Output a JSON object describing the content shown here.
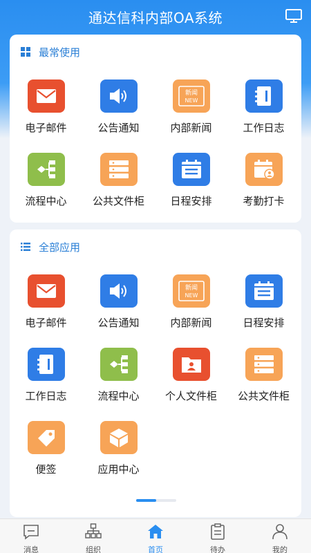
{
  "header": {
    "title": "通达信科内部OA系统",
    "right_icon": "monitor-icon"
  },
  "frequent": {
    "title": "最常使用",
    "icon": "grid-icon",
    "apps": [
      {
        "label": "电子邮件",
        "icon": "mail-icon",
        "color": "#e8502f"
      },
      {
        "label": "公告通知",
        "icon": "speaker-icon",
        "color": "#2f7de6"
      },
      {
        "label": "内部新闻",
        "icon": "news-icon",
        "color": "#f7a457"
      },
      {
        "label": "工作日志",
        "icon": "notebook-icon",
        "color": "#2f7de6"
      },
      {
        "label": "流程中心",
        "icon": "flow-icon",
        "color": "#8fbe4b"
      },
      {
        "label": "公共文件柜",
        "icon": "cabinet-icon",
        "color": "#f7a457"
      },
      {
        "label": "日程安排",
        "icon": "calendar-icon",
        "color": "#2f7de6"
      },
      {
        "label": "考勤打卡",
        "icon": "attendance-icon",
        "color": "#f7a457"
      }
    ]
  },
  "all": {
    "title": "全部应用",
    "icon": "list-icon",
    "apps": [
      {
        "label": "电子邮件",
        "icon": "mail-icon",
        "color": "#e8502f"
      },
      {
        "label": "公告通知",
        "icon": "speaker-icon",
        "color": "#2f7de6"
      },
      {
        "label": "内部新闻",
        "icon": "news-icon",
        "color": "#f7a457"
      },
      {
        "label": "日程安排",
        "icon": "calendar-icon",
        "color": "#2f7de6"
      },
      {
        "label": "工作日志",
        "icon": "notebook-icon",
        "color": "#2f7de6"
      },
      {
        "label": "流程中心",
        "icon": "flow-icon",
        "color": "#8fbe4b"
      },
      {
        "label": "个人文件柜",
        "icon": "personal-folder-icon",
        "color": "#e8502f"
      },
      {
        "label": "公共文件柜",
        "icon": "cabinet-icon",
        "color": "#f7a457"
      },
      {
        "label": "便签",
        "icon": "tag-icon",
        "color": "#f7a457"
      },
      {
        "label": "应用中心",
        "icon": "cube-icon",
        "color": "#f7a457"
      }
    ],
    "page_indicator": {
      "pages": 2,
      "current": 1
    }
  },
  "news_icon_text": {
    "top": "新闻",
    "bottom": "NEW"
  },
  "tabbar": {
    "active_color": "#2a8ef0",
    "tabs": [
      {
        "label": "消息",
        "icon": "message-icon",
        "active": false
      },
      {
        "label": "组织",
        "icon": "org-icon",
        "active": false
      },
      {
        "label": "首页",
        "icon": "home-icon",
        "active": true
      },
      {
        "label": "待办",
        "icon": "clipboard-icon",
        "active": false
      },
      {
        "label": "我的",
        "icon": "user-icon",
        "active": false
      }
    ]
  }
}
